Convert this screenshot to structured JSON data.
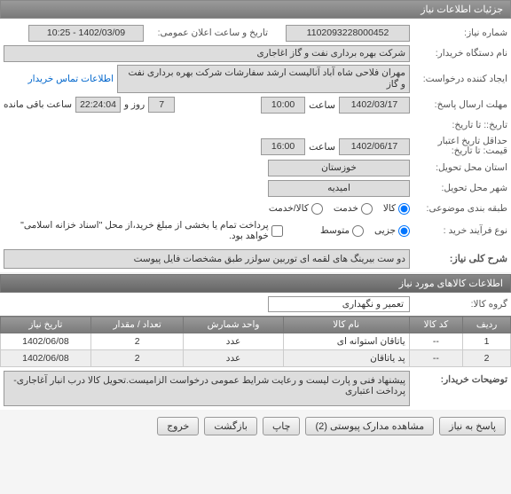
{
  "header": {
    "title": "جزئیات اطلاعات نیاز"
  },
  "form": {
    "need_no_label": "شماره نیاز:",
    "need_no": "1102093228000452",
    "announce_label": "تاریخ و ساعت اعلان عمومی:",
    "announce_value": "1402/03/09 - 10:25",
    "buyer_label": "نام دستگاه خریدار:",
    "buyer_value": "شرکت بهره برداری نفت و گاز اغاجاری",
    "requester_label": "ایجاد کننده درخواست:",
    "requester_value": "مهران فلاحی شاه آباد آنالیست ارشد سفارشات شرکت بهره برداری نفت و گاز",
    "contact_link": "اطلاعات تماس خریدار",
    "deadline_label": "مهلت ارسال پاسخ:",
    "deadline_date": "1402/03/17",
    "time_label": "ساعت",
    "deadline_time": "10:00",
    "days_count": "7",
    "days_label": "روز و",
    "time_remain": "22:24:04",
    "time_remain_label": "ساعت باقی مانده",
    "history_label_1": "تاریخ:: تا تاریخ:",
    "valid_label": "حداقل تاریخ اعتبار قیمت: تا تاریخ:",
    "valid_date": "1402/06/17",
    "valid_time": "16:00",
    "province_label": "استان محل تحویل:",
    "province_value": "خوزستان",
    "city_label": "شهر محل تحویل:",
    "city_value": "امیدیه",
    "subject_class_label": "طبقه بندی موضوعی:",
    "subject_goods": "کالا",
    "subject_service": "خدمت",
    "subject_both": "کالا/خدمت",
    "buy_type_label": "نوع فرآیند خرید :",
    "buy_type_partial": "جزیی",
    "buy_type_medium": "متوسط",
    "payment_note": "پرداخت تمام یا بخشی از مبلغ خرید،از محل \"اسناد خزانه اسلامی\" خواهد بود."
  },
  "desc": {
    "label": "شرح کلی نیاز:",
    "value": "دو ست بیرینگ های لقمه ای توربین سولزر طبق مشخصات فایل پیوست"
  },
  "goods_header": "اطلاعات کالاهای مورد نیاز",
  "goods_group": {
    "label": "گروه کالا:",
    "value": "تعمیر و نگهداری"
  },
  "table": {
    "headers": [
      "ردیف",
      "کد کالا",
      "نام کالا",
      "واحد شمارش",
      "تعداد / مقدار",
      "تاریخ نیاز"
    ],
    "rows": [
      {
        "idx": "1",
        "code": "--",
        "name": "یاتاقان استوانه ای",
        "unit": "عدد",
        "qty": "2",
        "date": "1402/06/08"
      },
      {
        "idx": "2",
        "code": "--",
        "name": "پد یاتاقان",
        "unit": "عدد",
        "qty": "2",
        "date": "1402/06/08"
      }
    ]
  },
  "buyer_notes": {
    "label": "توضیحات خریدار:",
    "value": "پیشنهاد فنی و پارت لیست و رعایت شرایط عمومی درخواست الزامیست.تحویل کالا درب انبار آغاجاری-پرداخت اعتباری"
  },
  "buttons": {
    "reply": "پاسخ به نیاز",
    "attachments": "مشاهده مدارک پیوستی (2)",
    "print": "چاپ",
    "back": "بازگشت",
    "exit": "خروج"
  }
}
